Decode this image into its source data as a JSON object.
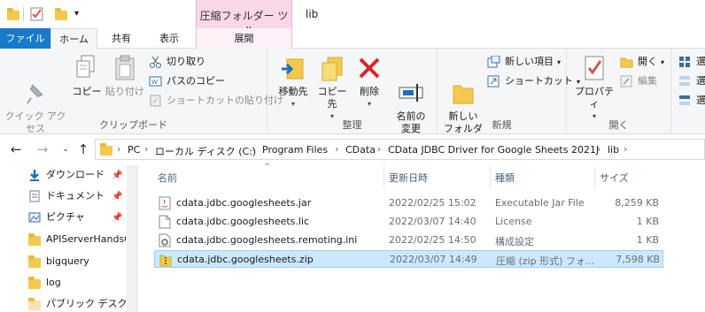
{
  "titlebar": {
    "contextual_tab_group": "圧縮フォルダー ツール",
    "window_title": "lib"
  },
  "tabs": {
    "file": "ファイル",
    "home": "ホーム",
    "share": "共有",
    "view": "表示",
    "manage": "展開"
  },
  "ribbon": {
    "clipboard": {
      "label": "クリップボード",
      "pin_quick_access": "クイック アクセス\nにピン留め",
      "copy": "コピー",
      "paste": "貼り付け",
      "cut": "切り取り",
      "copy_path": "パスのコピー",
      "paste_shortcut": "ショートカットの貼り付け"
    },
    "organize": {
      "label": "整理",
      "move_to": "移動先",
      "copy_to": "コピー先",
      "delete": "削除",
      "rename": "名前の\n変更"
    },
    "new": {
      "label": "新規",
      "new_folder": "新しい\nフォルダー",
      "new_item": "新しい項目",
      "shortcut": "ショートカット"
    },
    "open": {
      "label": "開く",
      "properties": "プロパティ",
      "open": "開く",
      "edit": "編集"
    },
    "select": {
      "item1": "選",
      "item2": "選",
      "item3": "選"
    }
  },
  "address": {
    "crumbs": [
      "PC",
      "ローカル ディスク (C:)",
      "Program Files",
      "CData",
      "CData JDBC Driver for Google Sheets 2021J",
      "lib"
    ]
  },
  "nav": {
    "items": [
      {
        "label": "ダウンロード",
        "icon": "download-icon",
        "pinned": true
      },
      {
        "label": "ドキュメント",
        "icon": "document-icon",
        "pinned": true
      },
      {
        "label": "ピクチャ",
        "icon": "pictures-icon",
        "pinned": true
      },
      {
        "label": "APIServerHandsO",
        "icon": "folder-icon",
        "pinned": false
      },
      {
        "label": "bigquery",
        "icon": "folder-icon",
        "pinned": false
      },
      {
        "label": "log",
        "icon": "folder-icon",
        "pinned": false
      },
      {
        "label": "パブリック デスクトップ",
        "icon": "folder-icon",
        "pinned": false
      }
    ]
  },
  "filelist": {
    "columns": {
      "name": "名前",
      "date": "更新日時",
      "type": "種類",
      "size": "サイズ"
    },
    "rows": [
      {
        "name": "cdata.jdbc.googlesheets.jar",
        "date": "2022/02/25 15:02",
        "type": "Executable Jar File",
        "size": "8,259 KB",
        "icon": "jar-icon",
        "selected": false
      },
      {
        "name": "cdata.jdbc.googlesheets.lic",
        "date": "2022/03/07 14:40",
        "type": "License",
        "size": "1 KB",
        "icon": "file-icon",
        "selected": false
      },
      {
        "name": "cdata.jdbc.googlesheets.remoting.ini",
        "date": "2022/02/25 14:50",
        "type": "構成設定",
        "size": "1 KB",
        "icon": "settings-file-icon",
        "selected": false
      },
      {
        "name": "cdata.jdbc.googlesheets.zip",
        "date": "2022/03/07 14:49",
        "type": "圧縮 (zip 形式) フォ...",
        "size": "7,598 KB",
        "icon": "zip-icon",
        "selected": true
      }
    ]
  },
  "colors": {
    "file_tab": "#1979ca",
    "context_tab": "#f9d6e8",
    "selection": "#cce8ff",
    "folder": "#f2c94c"
  }
}
